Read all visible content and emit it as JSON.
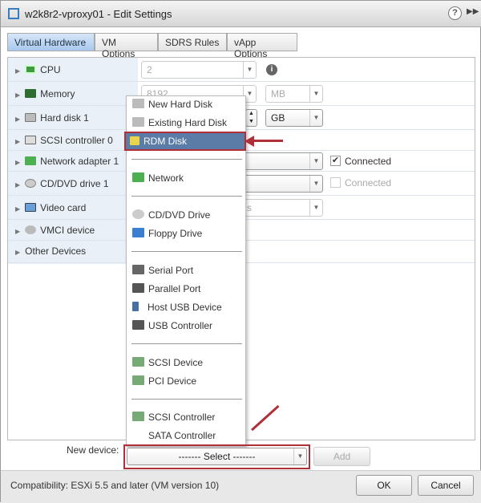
{
  "window": {
    "title": "w2k8r2-vproxy01 - Edit Settings",
    "help_icon": "question-circle-icon",
    "expand_icon": "double-chevron-right-icon"
  },
  "tabs": [
    {
      "label": "Virtual Hardware",
      "active": true
    },
    {
      "label": "VM Options"
    },
    {
      "label": "SDRS Rules"
    },
    {
      "label": "vApp Options"
    }
  ],
  "hardware": {
    "cpu": {
      "label": "CPU",
      "value": "2"
    },
    "memory": {
      "label": "Memory",
      "value": "8192",
      "unit": "MB"
    },
    "hard_disk": {
      "label": "Hard disk 1",
      "unit": "GB"
    },
    "scsi": {
      "label": "SCSI controller 0"
    },
    "network": {
      "label": "Network adapter 1",
      "connected_label": "Connected",
      "connected": true
    },
    "cddvd": {
      "label": "CD/DVD drive 1",
      "connected_label": "Connected",
      "connected": false
    },
    "video": {
      "label": "Video card",
      "value_partial": "s"
    },
    "vmci": {
      "label": "VMCI device"
    },
    "other": {
      "label": "Other Devices"
    }
  },
  "menu": {
    "items": [
      "New Hard Disk",
      "Existing Hard Disk",
      "RDM Disk",
      "Network",
      "CD/DVD Drive",
      "Floppy Drive",
      "Serial Port",
      "Parallel Port",
      "Host USB Device",
      "USB Controller",
      "SCSI Device",
      "PCI Device",
      "SCSI Controller",
      "SATA Controller"
    ],
    "highlighted": "RDM Disk"
  },
  "new_device": {
    "label": "New device:",
    "select_value": "------- Select -------",
    "add_label": "Add"
  },
  "footer": {
    "compatibility": "Compatibility: ESXi 5.5 and later (VM version 10)",
    "ok_label": "OK",
    "cancel_label": "Cancel"
  },
  "colors": {
    "highlight": "#5b7ca6",
    "annotation": "#b0303a",
    "tab_active": "#a9c8ee"
  }
}
